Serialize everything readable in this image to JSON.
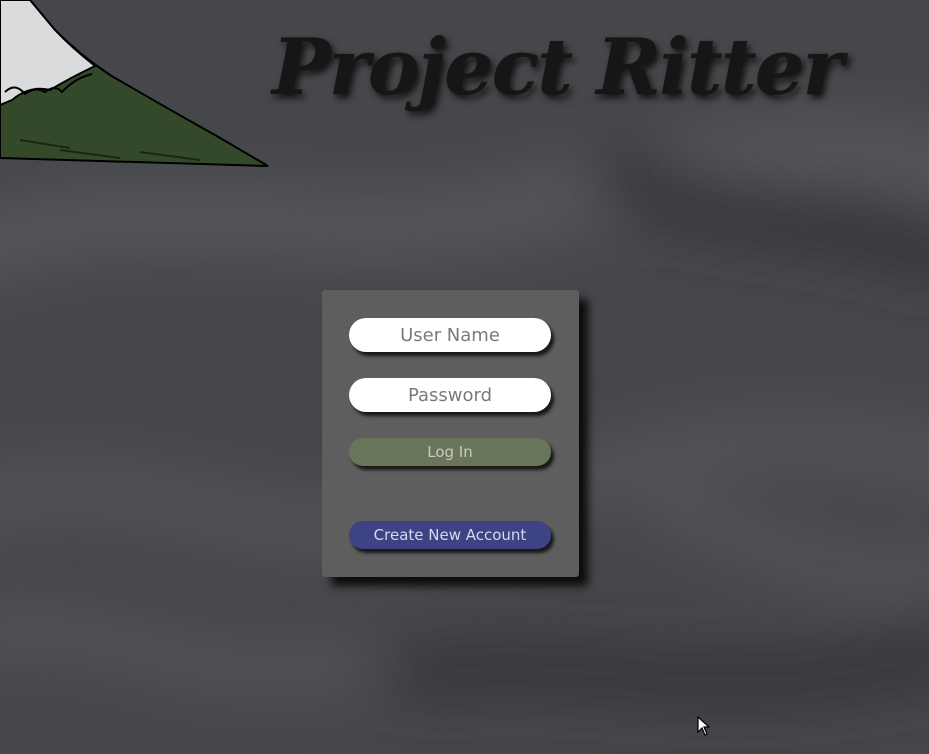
{
  "app": {
    "title": "Project Ritter"
  },
  "login_form": {
    "username_placeholder": "User Name",
    "password_placeholder": "Password",
    "login_label": "Log In",
    "create_account_label": "Create New Account"
  },
  "decorations": {
    "corner_art": "mountain-icon",
    "pointer": "cursor-icon"
  },
  "colors": {
    "background": "#47484a",
    "panel": "#5e5e5f",
    "login_button": "#697558",
    "create_button": "#3d4385",
    "title_text": "#161616"
  }
}
